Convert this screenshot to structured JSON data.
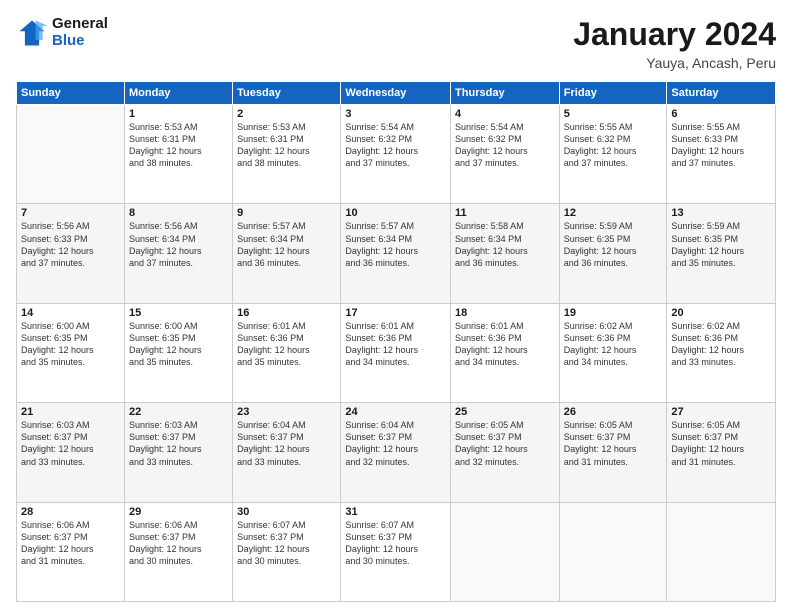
{
  "header": {
    "logo_line1": "General",
    "logo_line2": "Blue",
    "title": "January 2024",
    "subtitle": "Yauya, Ancash, Peru"
  },
  "calendar": {
    "days_of_week": [
      "Sunday",
      "Monday",
      "Tuesday",
      "Wednesday",
      "Thursday",
      "Friday",
      "Saturday"
    ],
    "weeks": [
      [
        {
          "day": "",
          "info": ""
        },
        {
          "day": "1",
          "info": "Sunrise: 5:53 AM\nSunset: 6:31 PM\nDaylight: 12 hours\nand 38 minutes."
        },
        {
          "day": "2",
          "info": "Sunrise: 5:53 AM\nSunset: 6:31 PM\nDaylight: 12 hours\nand 38 minutes."
        },
        {
          "day": "3",
          "info": "Sunrise: 5:54 AM\nSunset: 6:32 PM\nDaylight: 12 hours\nand 37 minutes."
        },
        {
          "day": "4",
          "info": "Sunrise: 5:54 AM\nSunset: 6:32 PM\nDaylight: 12 hours\nand 37 minutes."
        },
        {
          "day": "5",
          "info": "Sunrise: 5:55 AM\nSunset: 6:32 PM\nDaylight: 12 hours\nand 37 minutes."
        },
        {
          "day": "6",
          "info": "Sunrise: 5:55 AM\nSunset: 6:33 PM\nDaylight: 12 hours\nand 37 minutes."
        }
      ],
      [
        {
          "day": "7",
          "info": "Sunrise: 5:56 AM\nSunset: 6:33 PM\nDaylight: 12 hours\nand 37 minutes."
        },
        {
          "day": "8",
          "info": "Sunrise: 5:56 AM\nSunset: 6:34 PM\nDaylight: 12 hours\nand 37 minutes."
        },
        {
          "day": "9",
          "info": "Sunrise: 5:57 AM\nSunset: 6:34 PM\nDaylight: 12 hours\nand 36 minutes."
        },
        {
          "day": "10",
          "info": "Sunrise: 5:57 AM\nSunset: 6:34 PM\nDaylight: 12 hours\nand 36 minutes."
        },
        {
          "day": "11",
          "info": "Sunrise: 5:58 AM\nSunset: 6:34 PM\nDaylight: 12 hours\nand 36 minutes."
        },
        {
          "day": "12",
          "info": "Sunrise: 5:59 AM\nSunset: 6:35 PM\nDaylight: 12 hours\nand 36 minutes."
        },
        {
          "day": "13",
          "info": "Sunrise: 5:59 AM\nSunset: 6:35 PM\nDaylight: 12 hours\nand 35 minutes."
        }
      ],
      [
        {
          "day": "14",
          "info": "Sunrise: 6:00 AM\nSunset: 6:35 PM\nDaylight: 12 hours\nand 35 minutes."
        },
        {
          "day": "15",
          "info": "Sunrise: 6:00 AM\nSunset: 6:35 PM\nDaylight: 12 hours\nand 35 minutes."
        },
        {
          "day": "16",
          "info": "Sunrise: 6:01 AM\nSunset: 6:36 PM\nDaylight: 12 hours\nand 35 minutes."
        },
        {
          "day": "17",
          "info": "Sunrise: 6:01 AM\nSunset: 6:36 PM\nDaylight: 12 hours\nand 34 minutes."
        },
        {
          "day": "18",
          "info": "Sunrise: 6:01 AM\nSunset: 6:36 PM\nDaylight: 12 hours\nand 34 minutes."
        },
        {
          "day": "19",
          "info": "Sunrise: 6:02 AM\nSunset: 6:36 PM\nDaylight: 12 hours\nand 34 minutes."
        },
        {
          "day": "20",
          "info": "Sunrise: 6:02 AM\nSunset: 6:36 PM\nDaylight: 12 hours\nand 33 minutes."
        }
      ],
      [
        {
          "day": "21",
          "info": "Sunrise: 6:03 AM\nSunset: 6:37 PM\nDaylight: 12 hours\nand 33 minutes."
        },
        {
          "day": "22",
          "info": "Sunrise: 6:03 AM\nSunset: 6:37 PM\nDaylight: 12 hours\nand 33 minutes."
        },
        {
          "day": "23",
          "info": "Sunrise: 6:04 AM\nSunset: 6:37 PM\nDaylight: 12 hours\nand 33 minutes."
        },
        {
          "day": "24",
          "info": "Sunrise: 6:04 AM\nSunset: 6:37 PM\nDaylight: 12 hours\nand 32 minutes."
        },
        {
          "day": "25",
          "info": "Sunrise: 6:05 AM\nSunset: 6:37 PM\nDaylight: 12 hours\nand 32 minutes."
        },
        {
          "day": "26",
          "info": "Sunrise: 6:05 AM\nSunset: 6:37 PM\nDaylight: 12 hours\nand 31 minutes."
        },
        {
          "day": "27",
          "info": "Sunrise: 6:05 AM\nSunset: 6:37 PM\nDaylight: 12 hours\nand 31 minutes."
        }
      ],
      [
        {
          "day": "28",
          "info": "Sunrise: 6:06 AM\nSunset: 6:37 PM\nDaylight: 12 hours\nand 31 minutes."
        },
        {
          "day": "29",
          "info": "Sunrise: 6:06 AM\nSunset: 6:37 PM\nDaylight: 12 hours\nand 30 minutes."
        },
        {
          "day": "30",
          "info": "Sunrise: 6:07 AM\nSunset: 6:37 PM\nDaylight: 12 hours\nand 30 minutes."
        },
        {
          "day": "31",
          "info": "Sunrise: 6:07 AM\nSunset: 6:37 PM\nDaylight: 12 hours\nand 30 minutes."
        },
        {
          "day": "",
          "info": ""
        },
        {
          "day": "",
          "info": ""
        },
        {
          "day": "",
          "info": ""
        }
      ]
    ]
  }
}
